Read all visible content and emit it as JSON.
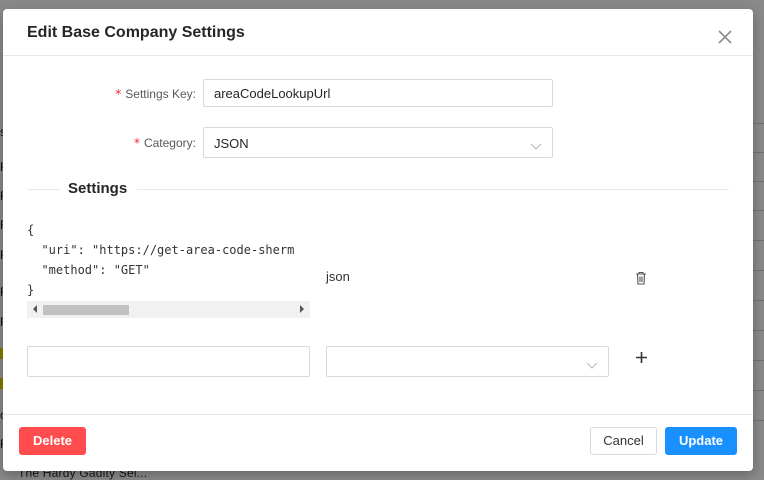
{
  "background": {
    "letters": [
      "s",
      "R",
      "R",
      "R",
      "R",
      "R",
      "R",
      "R",
      "o"
    ],
    "bottom_text": "The Hardy Gadity Sel..."
  },
  "modal": {
    "title": "Edit Base Company Settings",
    "close_icon": "close-icon"
  },
  "form": {
    "settings_key": {
      "label": "Settings Key",
      "value": "areaCodeLookupUrl",
      "required_mark": "*",
      "colon": ":"
    },
    "category": {
      "label": "Category",
      "value": "JSON",
      "required_mark": "*",
      "colon": ":"
    }
  },
  "settings_section": {
    "heading": "Settings",
    "entries": [
      {
        "value_text": "{\n  \"uri\": \"https://get-area-code-sherm\n  \"method\": \"GET\"\n}",
        "type": "json",
        "delete_icon": "trash-icon"
      }
    ],
    "new_entry": {
      "key_value": "",
      "type_value": "",
      "add_icon": "plus-icon"
    }
  },
  "footer": {
    "delete_label": "Delete",
    "cancel_label": "Cancel",
    "update_label": "Update"
  },
  "colors": {
    "primary": "#1890ff",
    "danger": "#ff4d4f",
    "required": "#f5222d",
    "border": "#d9d9d9"
  }
}
